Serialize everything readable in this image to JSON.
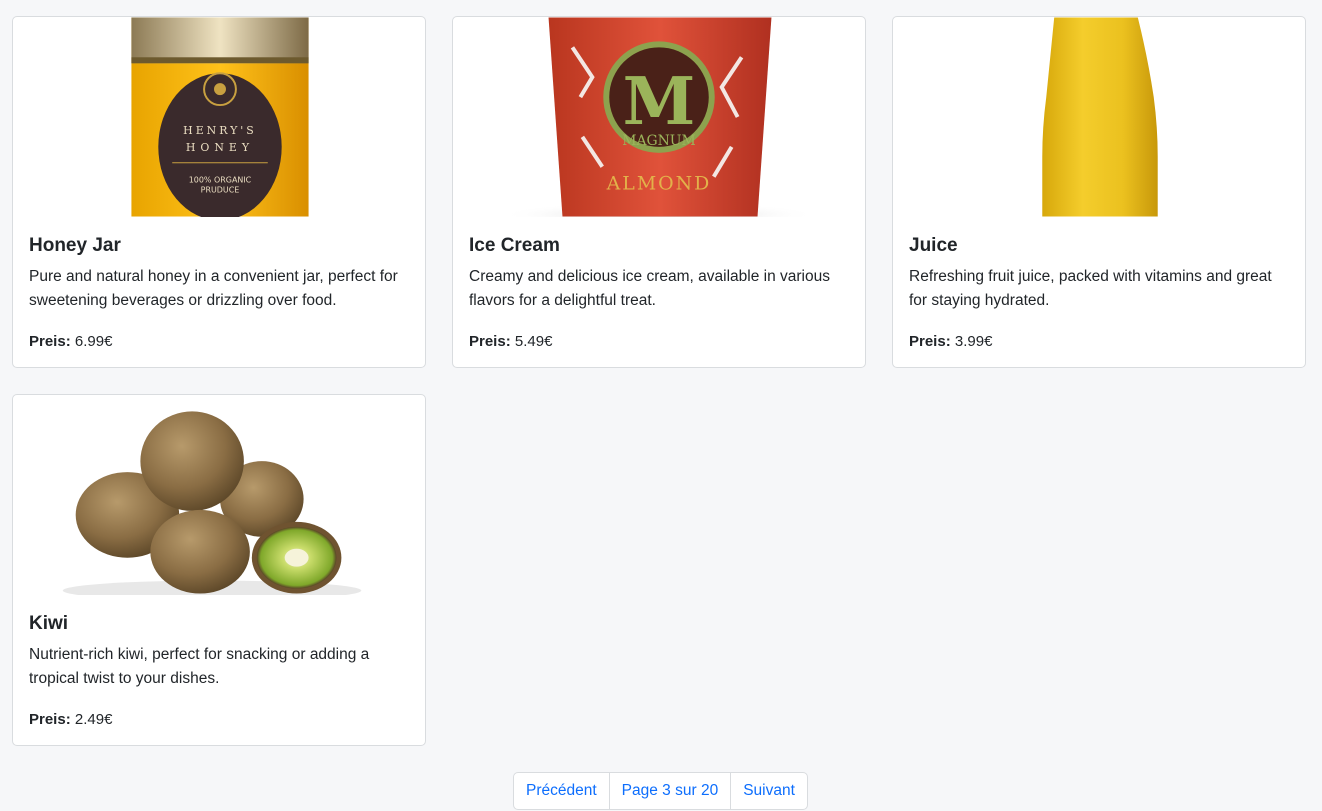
{
  "currency": "€",
  "price_label": "Preis:",
  "products": [
    {
      "name": "Honey Jar",
      "description": "Pure and natural honey in a convenient jar, perfect for sweetening beverages or drizzling over food.",
      "price": "6.99€",
      "image_label_line1": "HENRY'S",
      "image_label_line2": "HONEY",
      "image_label_line3": "100% ORGANIC",
      "image_label_line4": "PRUDUCE"
    },
    {
      "name": "Ice Cream",
      "description": "Creamy and delicious ice cream, available in various flavors for a delightful treat.",
      "price": "5.49€",
      "image_logo_letter": "M",
      "image_brand": "MAGNUM",
      "image_flavor": "ALMOND"
    },
    {
      "name": "Juice",
      "description": "Refreshing fruit juice, packed with vitamins and great for staying hydrated.",
      "price": "3.99€"
    },
    {
      "name": "Kiwi",
      "description": "Nutrient-rich kiwi, perfect for snacking or adding a tropical twist to your dishes.",
      "price": "2.49€"
    }
  ],
  "pagination": {
    "previous_label": "Précédent",
    "current_label": "Page 3 sur 20",
    "next_label": "Suivant"
  },
  "colors": {
    "link": "#0d6efd",
    "page_bg": "#f6f7f9",
    "card_border": "#d9dcdf"
  }
}
